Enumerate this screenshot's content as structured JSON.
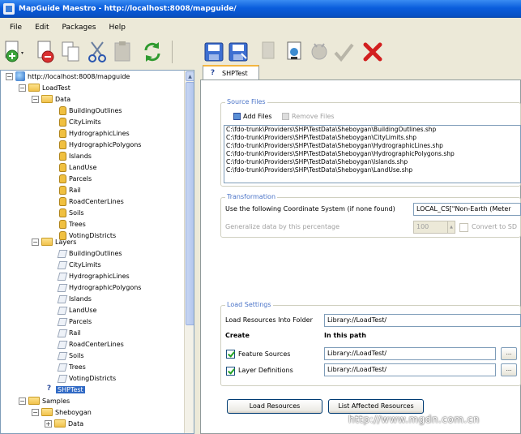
{
  "window": {
    "title": "MapGuide Maestro - http://localhost:8008/mapguide/"
  },
  "menu": [
    "File",
    "Edit",
    "Packages",
    "Help"
  ],
  "tree": {
    "root": "http://localhost:8008/mapguide",
    "load_test": "LoadTest",
    "data_folder": "Data",
    "data_items": [
      "BuildingOutlines",
      "CityLimits",
      "HydrographicLines",
      "HydrographicPolygons",
      "Islands",
      "LandUse",
      "Parcels",
      "Rail",
      "RoadCenterLines",
      "Soils",
      "Trees",
      "VotingDistricts"
    ],
    "layers_folder": "Layers",
    "layer_items": [
      "BuildingOutlines",
      "CityLimits",
      "HydrographicLines",
      "HydrographicPolygons",
      "Islands",
      "LandUse",
      "Parcels",
      "Rail",
      "RoadCenterLines",
      "Soils",
      "Trees",
      "VotingDistricts"
    ],
    "selected": "SHPTest",
    "samples": "Samples",
    "sheboygan": "Sheboygan",
    "sheboygan_data": "Data"
  },
  "tab": {
    "label": "SHPTest"
  },
  "source_files": {
    "legend": "Source Files",
    "add_label": "Add Files",
    "remove_label": "Remove Files",
    "files": [
      "C:\\fdo-trunk\\Providers\\SHP\\TestData\\Sheboygan\\BuildingOutlines.shp",
      "C:\\fdo-trunk\\Providers\\SHP\\TestData\\Sheboygan\\CityLimits.shp",
      "C:\\fdo-trunk\\Providers\\SHP\\TestData\\Sheboygan\\HydrographicLines.shp",
      "C:\\fdo-trunk\\Providers\\SHP\\TestData\\Sheboygan\\HydrographicPolygons.shp",
      "C:\\fdo-trunk\\Providers\\SHP\\TestData\\Sheboygan\\Islands.shp",
      "C:\\fdo-trunk\\Providers\\SHP\\TestData\\Sheboygan\\LandUse.shp"
    ]
  },
  "transformation": {
    "legend": "Transformation",
    "coord_label": "Use the following Coordinate System (if none found)",
    "coord_value": "LOCAL_CS[\"Non-Earth (Meter",
    "generalize_label": "Generalize data by this percentage",
    "generalize_value": "100",
    "convert_label": "Convert to SD"
  },
  "load_settings": {
    "legend": "Load Settings",
    "folder_label": "Load Resources Into Folder",
    "folder_value": "Library://LoadTest/",
    "create_header": "Create",
    "path_header": "In this path",
    "feature_label": "Feature Sources",
    "feature_path": "Library://LoadTest/",
    "layer_label": "Layer Definitions",
    "layer_path": "Library://LoadTest/",
    "browse_label": "..."
  },
  "buttons": {
    "load": "Load Resources",
    "list": "List Affected Resources"
  },
  "watermark": "http://www.mgdn.com.cn"
}
